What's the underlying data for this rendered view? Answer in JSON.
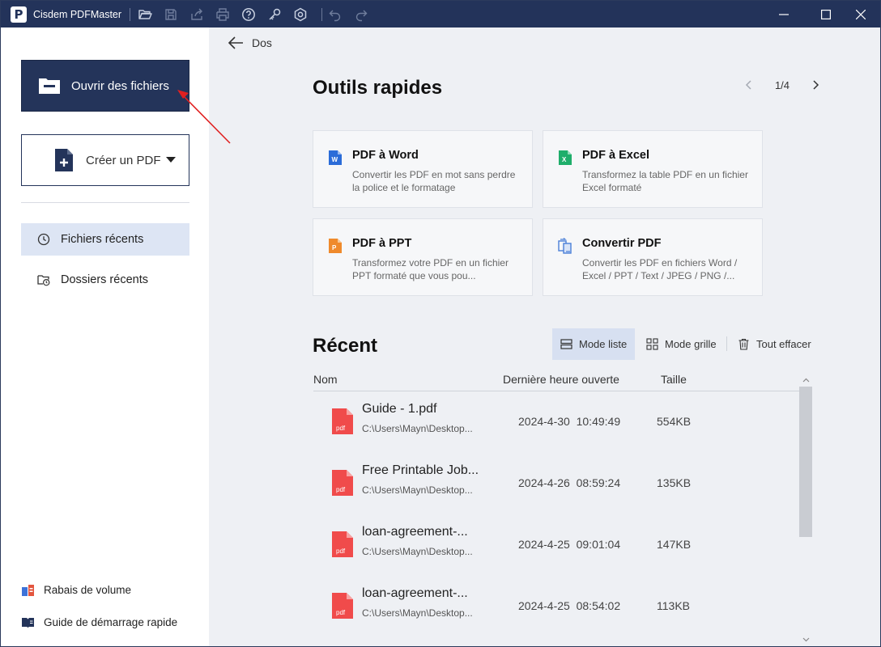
{
  "app": {
    "title": "Cisdem PDFMaster"
  },
  "toolbar": {
    "icons": [
      "open-folder-icon",
      "save-icon",
      "share-icon",
      "print-icon",
      "help-icon",
      "key-icon",
      "settings-icon",
      "undo-icon",
      "redo-icon"
    ]
  },
  "sidebar": {
    "open_label": "Ouvrir des fichiers",
    "create_label": "Créer un PDF",
    "items": [
      {
        "label": "Fichiers récents",
        "icon": "clock-icon",
        "active": true
      },
      {
        "label": "Dossiers récents",
        "icon": "folder-clock-icon",
        "active": false
      }
    ],
    "footer": [
      {
        "label": "Rabais de volume",
        "icon": "volume-discount-icon"
      },
      {
        "label": "Guide de démarrage rapide",
        "icon": "guide-book-icon"
      }
    ]
  },
  "back_label": "Dos",
  "quick_tools": {
    "title": "Outils rapides",
    "page": "1/4",
    "cards": [
      {
        "title": "PDF à Word",
        "desc": "Convertir les PDF en mot sans perdre la police et le formatage",
        "icon": "word-icon",
        "color": "#2b6cd8"
      },
      {
        "title": "PDF à Excel",
        "desc": "Transformez la table PDF en un fichier Excel formaté",
        "icon": "excel-icon",
        "color": "#1fae6b"
      },
      {
        "title": "PDF à PPT",
        "desc": "Transformez votre PDF en un fichier PPT formaté que vous pou...",
        "icon": "ppt-icon",
        "color": "#ef8a2c"
      },
      {
        "title": "Convertir PDF",
        "desc": "Convertir les PDF en fichiers Word / Excel / PPT / Text / JPEG / PNG /...",
        "icon": "convert-icon",
        "color": "#4a7fd8"
      }
    ]
  },
  "recent": {
    "title": "Récent",
    "list_mode": "Mode liste",
    "grid_mode": "Mode grille",
    "clear_all": "Tout effacer",
    "columns": {
      "name": "Nom",
      "last_opened": "Dernière heure ouverte",
      "size": "Taille"
    },
    "files": [
      {
        "name": "Guide - 1.pdf",
        "path": "C:\\Users\\Mayn\\Desktop...",
        "date": "2024-4-30  10:49:49",
        "size": "554KB"
      },
      {
        "name": "Free Printable Job...",
        "path": "C:\\Users\\Mayn\\Desktop...",
        "date": "2024-4-26  08:59:24",
        "size": "135KB"
      },
      {
        "name": "loan-agreement-...",
        "path": "C:\\Users\\Mayn\\Desktop...",
        "date": "2024-4-25  09:01:04",
        "size": "147KB"
      },
      {
        "name": "loan-agreement-...",
        "path": "C:\\Users\\Mayn\\Desktop...",
        "date": "2024-4-25  08:54:02",
        "size": "113KB"
      }
    ]
  },
  "colors": {
    "navy": "#23335a",
    "pdf_red": "#f04b4b",
    "annotation": "#e02020",
    "active_bg": "#dde5f4"
  }
}
